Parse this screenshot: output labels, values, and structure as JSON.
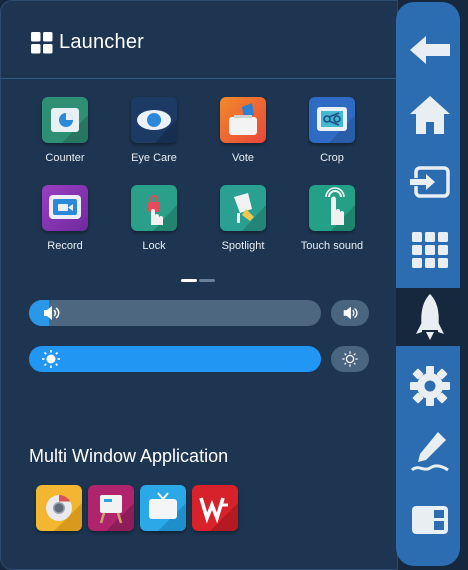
{
  "header": {
    "title": "Launcher"
  },
  "apps": [
    {
      "label": "Counter"
    },
    {
      "label": "Eye Care"
    },
    {
      "label": "Vote"
    },
    {
      "label": "Crop"
    },
    {
      "label": "Record"
    },
    {
      "label": "Lock"
    },
    {
      "label": "Spotlight"
    },
    {
      "label": "Touch sound"
    }
  ],
  "pager": {
    "current_page": 1,
    "total_pages": 2
  },
  "sliders": {
    "volume": {
      "icon": "speaker-icon",
      "level": 0.02
    },
    "brightness": {
      "icon": "sun-icon",
      "level": 1.0
    }
  },
  "multi_window": {
    "title": "Multi Window Application",
    "apps": [
      {
        "icon": "chrome-icon"
      },
      {
        "icon": "easel-icon"
      },
      {
        "icon": "tv-icon"
      },
      {
        "icon": "wps-icon"
      }
    ]
  },
  "sidebar": {
    "items": [
      {
        "icon": "back-arrow-icon"
      },
      {
        "icon": "home-icon"
      },
      {
        "icon": "input-source-icon"
      },
      {
        "icon": "apps-grid-icon"
      },
      {
        "icon": "rocket-icon",
        "selected": true
      },
      {
        "icon": "settings-gear-icon"
      },
      {
        "icon": "pen-annotate-icon"
      },
      {
        "icon": "whiteboard-icon"
      }
    ]
  },
  "colors": {
    "panel": "#1d3550",
    "sidebar": "#2b6db0",
    "accent": "#2196f3",
    "track": "#4d6780"
  }
}
